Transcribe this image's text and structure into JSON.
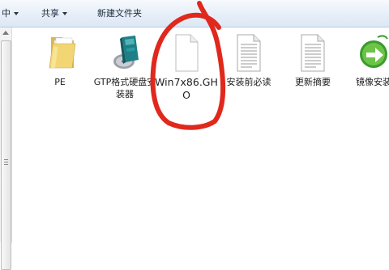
{
  "toolbar": {
    "partial_label": "中",
    "share_label": "共享",
    "new_folder_label": "新建文件夹"
  },
  "files": [
    {
      "label": "PE",
      "icon": "folder-icon"
    },
    {
      "label": "GTP格式硬盘安装器",
      "icon": "installer-app-icon"
    },
    {
      "label": "Win7x86.GHO",
      "icon": "blank-file-icon"
    },
    {
      "label": "安装前必读",
      "icon": "text-file-icon"
    },
    {
      "label": "更新摘要",
      "icon": "text-file-icon"
    },
    {
      "label": "镜像安装",
      "icon": "green-arrow-app-icon"
    }
  ],
  "colors": {
    "annotation": "#e0281c",
    "toolbar_bg": "#e6eef8"
  }
}
